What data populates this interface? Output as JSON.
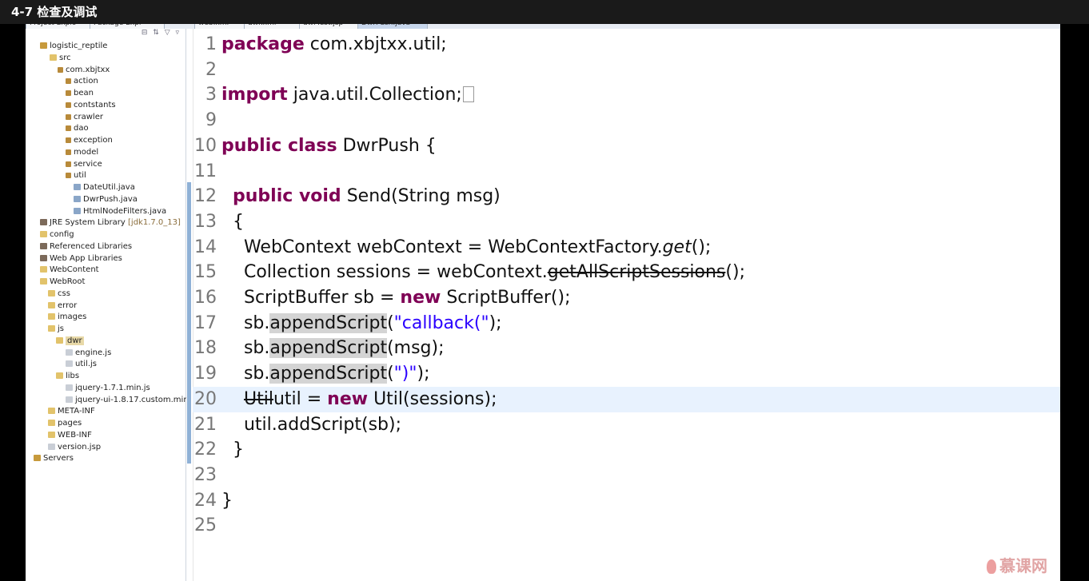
{
  "title": "4-7 检查及调试",
  "tabs": [
    "Project Explo",
    "Package Expl",
    "web.xml",
    "dwr.xml",
    "dwrTest.jsp",
    "DwrPush.java"
  ],
  "explorer": {
    "toolbar": "⊟ ⇅ ▽ ▿",
    "items": [
      {
        "label": "logistic_reptile",
        "icon": "project-icon"
      },
      {
        "label": "src",
        "icon": "folder-icon"
      },
      {
        "label": "com.xbjtxx",
        "icon": "package-icon"
      },
      {
        "label": "action",
        "icon": "package-icon"
      },
      {
        "label": "bean",
        "icon": "package-icon"
      },
      {
        "label": "contstants",
        "icon": "package-icon"
      },
      {
        "label": "crawler",
        "icon": "package-icon"
      },
      {
        "label": "dao",
        "icon": "package-icon"
      },
      {
        "label": "exception",
        "icon": "package-icon"
      },
      {
        "label": "model",
        "icon": "package-icon"
      },
      {
        "label": "service",
        "icon": "package-icon"
      },
      {
        "label": "util",
        "icon": "package-icon"
      },
      {
        "label": "DateUtil.java",
        "icon": "java-file-icon"
      },
      {
        "label": "DwrPush.java",
        "icon": "java-file-icon"
      },
      {
        "label": "HtmlNodeFilters.java",
        "icon": "java-file-icon"
      },
      {
        "label": "JRE System Library",
        "extra": "[jdk1.7.0_13]",
        "icon": "library-icon"
      },
      {
        "label": "config",
        "icon": "folder-icon"
      },
      {
        "label": "Referenced Libraries",
        "icon": "library-icon"
      },
      {
        "label": "Web App Libraries",
        "icon": "library-icon"
      },
      {
        "label": "WebContent",
        "icon": "folder-icon"
      },
      {
        "label": "WebRoot",
        "icon": "folder-icon"
      },
      {
        "label": "css",
        "icon": "folder-icon"
      },
      {
        "label": "error",
        "icon": "folder-icon"
      },
      {
        "label": "images",
        "icon": "folder-icon"
      },
      {
        "label": "js",
        "icon": "folder-icon"
      },
      {
        "label": "dwr",
        "icon": "folder-icon"
      },
      {
        "label": "engine.js",
        "icon": "file-icon"
      },
      {
        "label": "util.js",
        "icon": "file-icon"
      },
      {
        "label": "libs",
        "icon": "folder-icon"
      },
      {
        "label": "jquery-1.7.1.min.js",
        "icon": "file-icon"
      },
      {
        "label": "jquery-ui-1.8.17.custom.min.",
        "icon": "file-icon"
      },
      {
        "label": "META-INF",
        "icon": "folder-icon"
      },
      {
        "label": "pages",
        "icon": "folder-icon"
      },
      {
        "label": "WEB-INF",
        "icon": "folder-icon"
      },
      {
        "label": "version.jsp",
        "icon": "file-icon"
      },
      {
        "label": "Servers",
        "icon": "project-icon"
      }
    ]
  },
  "editor": {
    "lines": [
      {
        "num": "1",
        "parts": [
          [
            "kw",
            "package"
          ],
          [
            "",
            "com.xbjtxx.util;"
          ]
        ]
      },
      {
        "num": "2",
        "parts": []
      },
      {
        "num": "3",
        "parts": [
          [
            "kw",
            "import"
          ],
          [
            "",
            "java.util.Collection;"
          ]
        ]
      },
      {
        "num": "9",
        "parts": []
      },
      {
        "num": "10",
        "parts": [
          [
            "kw",
            "public class"
          ],
          [
            "",
            "DwrPush {"
          ]
        ]
      },
      {
        "num": "11",
        "parts": []
      },
      {
        "num": "12",
        "parts": [
          [
            "",
            "  "
          ],
          [
            "kw",
            "public void"
          ],
          [
            "",
            "Send(String msg)"
          ]
        ]
      },
      {
        "num": "13",
        "parts": [
          [
            "",
            "  {"
          ]
        ]
      },
      {
        "num": "14",
        "parts": [
          [
            "",
            "    WebContext webContext = WebContextFactory."
          ],
          [
            "ital",
            "get"
          ],
          [
            "",
            "();"
          ]
        ]
      },
      {
        "num": "15",
        "parts": [
          [
            "",
            "    Collection sessions = webContext."
          ],
          [
            "strike",
            "getAllScriptSessions"
          ],
          [
            "",
            "();"
          ]
        ]
      },
      {
        "num": "16",
        "parts": [
          [
            "",
            "    ScriptBuffer sb = "
          ],
          [
            "kw",
            "new"
          ],
          [
            "",
            "ScriptBuffer();"
          ]
        ]
      },
      {
        "num": "17",
        "parts": [
          [
            "",
            "    sb."
          ],
          [
            "hl",
            "appendScript"
          ],
          [
            "",
            "("
          ],
          [
            "str",
            "\"callback(\""
          ],
          [
            "",
            ");"
          ]
        ]
      },
      {
        "num": "18",
        "parts": [
          [
            "",
            "    sb."
          ],
          [
            "hl",
            "appendScript"
          ],
          [
            "",
            "(msg);"
          ]
        ]
      },
      {
        "num": "19",
        "parts": [
          [
            "",
            "    sb."
          ],
          [
            "hl",
            "appendScript"
          ],
          [
            "",
            "("
          ],
          [
            "str",
            "\")\""
          ],
          [
            "",
            ");"
          ]
        ]
      },
      {
        "num": "20",
        "parts": [
          [
            "",
            "    "
          ],
          [
            "strike",
            "Util"
          ],
          [
            "",
            "util = "
          ],
          [
            "kw",
            "new"
          ],
          [
            "",
            "Util(sessions);"
          ]
        ]
      },
      {
        "num": "21",
        "parts": [
          [
            "",
            "    util.addScript(sb);"
          ]
        ]
      },
      {
        "num": "22",
        "parts": [
          [
            "",
            "  }"
          ]
        ]
      },
      {
        "num": "23",
        "parts": []
      },
      {
        "num": "24",
        "parts": [
          [
            "",
            "}"
          ]
        ]
      },
      {
        "num": "25",
        "parts": []
      }
    ],
    "current_line": "20"
  },
  "watermark": "慕课网"
}
